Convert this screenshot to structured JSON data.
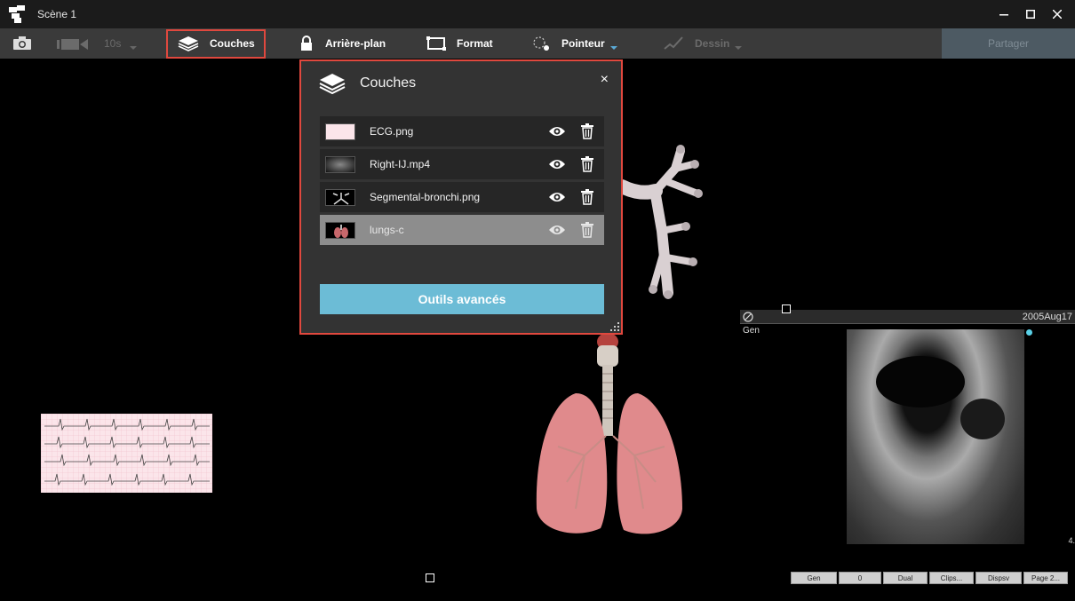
{
  "window": {
    "title": "Scène 1"
  },
  "toolbar": {
    "timer_label": "10s",
    "couches_label": "Couches",
    "arriere_plan_label": "Arrière-plan",
    "format_label": "Format",
    "pointeur_label": "Pointeur",
    "dessin_label": "Dessin",
    "share_label": "Partager"
  },
  "layers_panel": {
    "title": "Couches",
    "close_glyph": "×",
    "layers": [
      {
        "name": "ECG.png",
        "thumb": "ecg"
      },
      {
        "name": "Right-IJ.mp4",
        "thumb": "ultrasound"
      },
      {
        "name": "Segmental-bronchi.png",
        "thumb": "bronchi"
      },
      {
        "name": "lungs-c",
        "thumb": "lungs",
        "selected": true
      }
    ],
    "advanced_button": "Outils avancés"
  },
  "ultrasound": {
    "date": "2005Aug17",
    "mode_label": "Gen",
    "depth_value": "4.",
    "controls": [
      "Gen",
      "0",
      "Dual",
      "Clips...",
      "Dispsv",
      "Page 2..."
    ]
  },
  "colors": {
    "accent": "#6cbcd6",
    "highlight": "#e0483e",
    "toolbar": "#3a3a3a",
    "panel": "#333333"
  }
}
